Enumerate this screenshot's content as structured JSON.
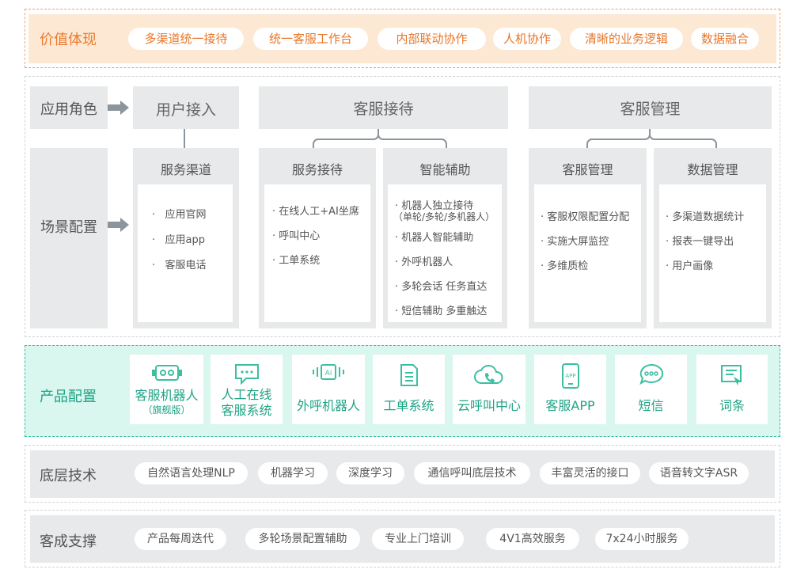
{
  "value": {
    "title": "价值体现",
    "items": [
      "多渠道统一接待",
      "统一客服工作台",
      "内部联动协作",
      "人机协作",
      "清晰的业务逻辑",
      "数据融合"
    ]
  },
  "roles": {
    "label": "应用角色",
    "user_access": "用户接入",
    "cs_reception": "客服接待",
    "cs_management": "客服管理"
  },
  "scene": {
    "label": "场景配置",
    "columns": [
      {
        "title": "服务渠道",
        "items": [
          "应用官网",
          "应用app",
          "客服电话"
        ]
      },
      {
        "title": "服务接待",
        "items": [
          "在线人工+AI坐席",
          "呼叫中心",
          "工单系统"
        ]
      },
      {
        "title": "智能辅助",
        "items": [
          "机器人独立接待",
          "（单轮/多轮/多机器人）",
          "机器人智能辅助",
          "外呼机器人",
          "多轮会话 任务直达",
          "短信辅助 多重触达"
        ]
      },
      {
        "title": "客服管理",
        "items": [
          "客服权限配置分配",
          "实施大屏监控",
          "多维质检"
        ]
      },
      {
        "title": "数据管理",
        "items": [
          "多渠道数据统计",
          "报表一键导出",
          "用户画像"
        ]
      }
    ]
  },
  "product": {
    "title": "产品配置",
    "cards": [
      {
        "label": "客服机器人",
        "sub": "（旗舰版）",
        "icon": "robot-icon"
      },
      {
        "label": "人工在线",
        "label2": "客服系统",
        "icon": "chat-bubble-icon"
      },
      {
        "label": "外呼机器人",
        "icon": "ai-voice-icon"
      },
      {
        "label": "工单系统",
        "icon": "document-icon"
      },
      {
        "label": "云呼叫中心",
        "icon": "cloud-phone-icon"
      },
      {
        "label": "客服APP",
        "icon": "mobile-app-icon",
        "icon_text": "APP"
      },
      {
        "label": "短信",
        "icon": "sms-bubble-icon"
      },
      {
        "label": "词条",
        "icon": "entry-icon"
      }
    ]
  },
  "tech": {
    "title": "底层技术",
    "items": [
      "自然语言处理NLP",
      "机器学习",
      "深度学习",
      "通信呼叫底层技术",
      "丰富灵活的接口",
      "语音转文字ASR"
    ]
  },
  "support": {
    "title": "客成支撑",
    "items": [
      "产品每周迭代",
      "多轮场景配置辅助",
      "专业上门培训",
      "4V1高效服务",
      "7x24小时服务"
    ]
  },
  "colors": {
    "orange": "#ea7a2e",
    "orange_bg": "#fde8d4",
    "teal": "#1fa385",
    "teal_bg": "#d9f6ef",
    "grey_bg": "#e8e9ea",
    "arrow": "#8c959c"
  }
}
